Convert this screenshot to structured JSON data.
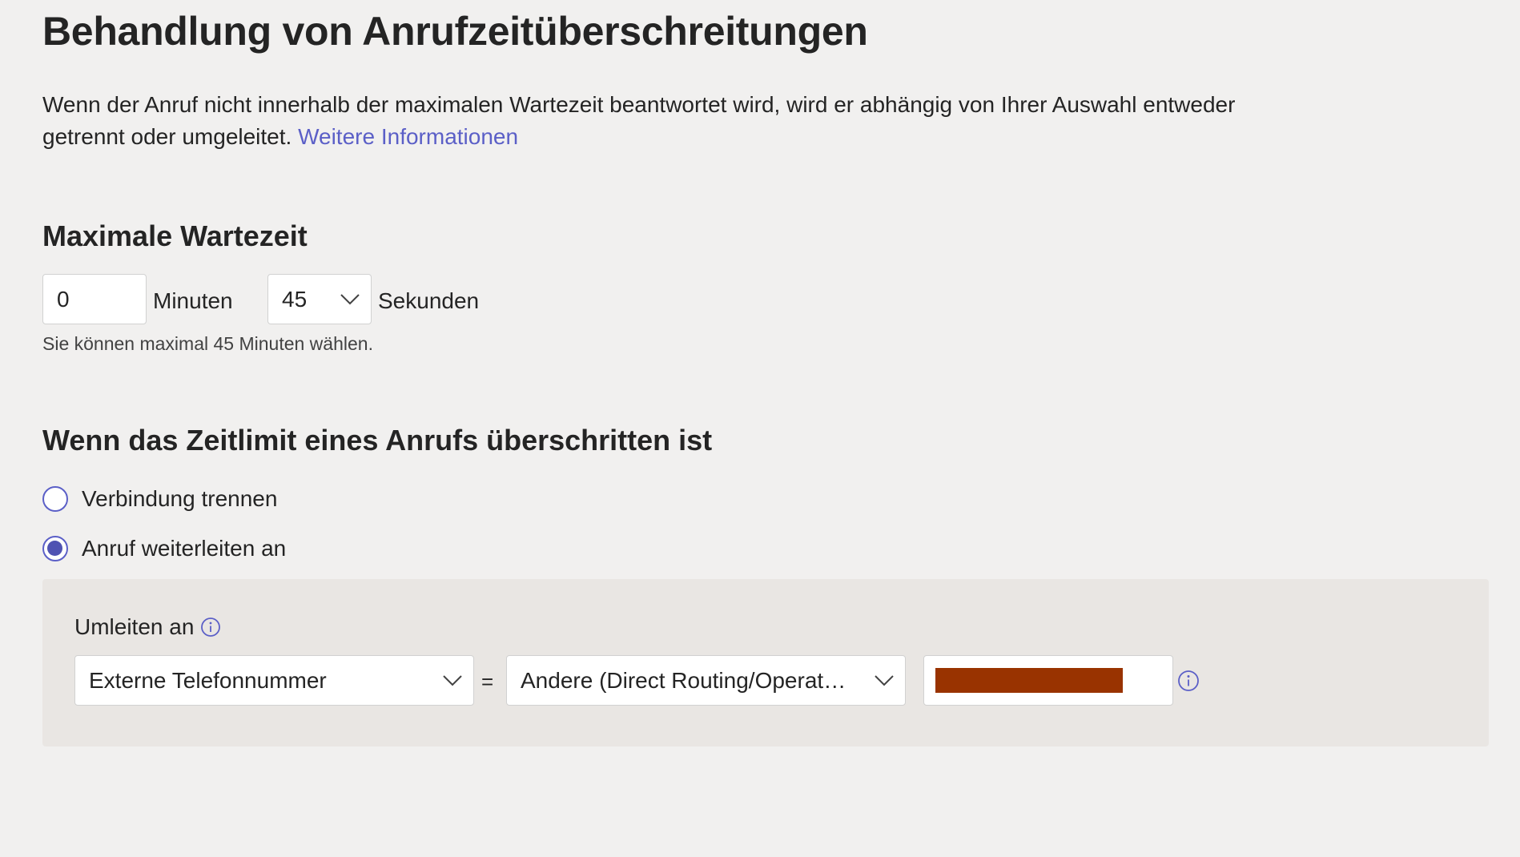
{
  "page": {
    "title": "Behandlung von Anrufzeitüberschreitungen",
    "description": "Wenn der Anruf nicht innerhalb der maximalen Wartezeit beantwortet wird, wird er abhängig von Ihrer Auswahl entweder getrennt oder umgeleitet.",
    "learn_more_link": "Weitere Informationen"
  },
  "max_wait": {
    "heading": "Maximale Wartezeit",
    "minutes_value": "0",
    "minutes_label": "Minuten",
    "seconds_value": "45",
    "seconds_label": "Sekunden",
    "hint": "Sie können maximal 45 Minuten wählen."
  },
  "timeout_action": {
    "heading": "Wenn das Zeitlimit eines Anrufs überschritten ist",
    "options": [
      {
        "label": "Verbindung trennen",
        "checked": false
      },
      {
        "label": "Anruf weiterleiten an",
        "checked": true
      }
    ]
  },
  "redirect": {
    "label": "Umleiten an",
    "target_type": "Externe Telefonnummer",
    "equals": "=",
    "routing": "Andere (Direct Routing/Operator...",
    "number_redacted": true
  },
  "colors": {
    "accent": "#5b5fc7",
    "radio_fill": "#4f52b2",
    "redaction": "#993300",
    "background": "#f1f0ef",
    "panel": "#e9e6e3"
  },
  "icons": [
    "chevron-down-icon",
    "info-icon"
  ]
}
